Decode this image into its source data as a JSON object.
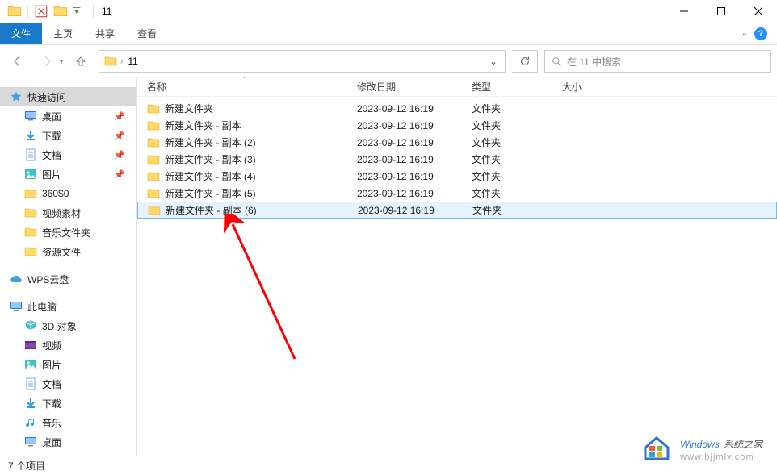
{
  "window": {
    "title": "11"
  },
  "nav": {
    "address_crumb": "11",
    "search_placeholder": "在 11 中搜索"
  },
  "tabs": {
    "file": "文件",
    "home": "主页",
    "share": "共享",
    "view": "查看"
  },
  "columns": {
    "name": "名称",
    "date": "修改日期",
    "type": "类型",
    "size": "大小"
  },
  "sidebar": {
    "quick_access": "快速访问",
    "items_quick": [
      {
        "label": "桌面",
        "pinned": true,
        "icon": "desktop"
      },
      {
        "label": "下载",
        "pinned": true,
        "icon": "download"
      },
      {
        "label": "文档",
        "pinned": true,
        "icon": "document"
      },
      {
        "label": "图片",
        "pinned": true,
        "icon": "picture"
      },
      {
        "label": "360$0",
        "pinned": false,
        "icon": "folder"
      },
      {
        "label": "视频素材",
        "pinned": false,
        "icon": "folder"
      },
      {
        "label": "音乐文件夹",
        "pinned": false,
        "icon": "folder"
      },
      {
        "label": "资源文件",
        "pinned": false,
        "icon": "folder"
      }
    ],
    "wps": "WPS云盘",
    "this_pc": "此电脑",
    "items_pc": [
      {
        "label": "3D 对象",
        "icon": "3d"
      },
      {
        "label": "视频",
        "icon": "video"
      },
      {
        "label": "图片",
        "icon": "picture"
      },
      {
        "label": "文档",
        "icon": "document"
      },
      {
        "label": "下载",
        "icon": "download"
      },
      {
        "label": "音乐",
        "icon": "music"
      },
      {
        "label": "桌面",
        "icon": "desktop"
      }
    ]
  },
  "files": [
    {
      "name": "新建文件夹",
      "date": "2023-09-12 16:19",
      "type": "文件夹",
      "selected": false
    },
    {
      "name": "新建文件夹 - 副本",
      "date": "2023-09-12 16:19",
      "type": "文件夹",
      "selected": false
    },
    {
      "name": "新建文件夹 - 副本 (2)",
      "date": "2023-09-12 16:19",
      "type": "文件夹",
      "selected": false
    },
    {
      "name": "新建文件夹 - 副本 (3)",
      "date": "2023-09-12 16:19",
      "type": "文件夹",
      "selected": false
    },
    {
      "name": "新建文件夹 - 副本 (4)",
      "date": "2023-09-12 16:19",
      "type": "文件夹",
      "selected": false
    },
    {
      "name": "新建文件夹 - 副本 (5)",
      "date": "2023-09-12 16:19",
      "type": "文件夹",
      "selected": false
    },
    {
      "name": "新建文件夹 - 副本 (6)",
      "date": "2023-09-12 16:19",
      "type": "文件夹",
      "selected": true
    }
  ],
  "status": {
    "item_count": "7 个项目"
  },
  "watermark": {
    "brand_en": "Windows",
    "brand_cn": "系统之家",
    "url": "www.bjjmlv.com"
  }
}
